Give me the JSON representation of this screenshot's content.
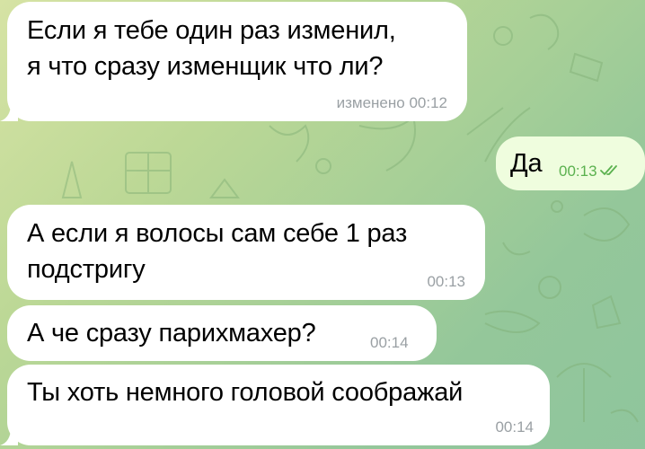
{
  "messages": [
    {
      "text_line1": "Если я тебе один раз изменил,",
      "text_line2": "я что сразу изменщик что ли?",
      "meta": "изменено 00:12",
      "direction": "incoming"
    },
    {
      "text": "Да",
      "meta": "00:13",
      "status": "read",
      "direction": "outgoing"
    },
    {
      "text_line1": "А если я волосы сам себе 1 раз",
      "text_line2": "подстригу",
      "meta": "00:13",
      "direction": "incoming"
    },
    {
      "text": "А че сразу парихмахер?",
      "meta": "00:14",
      "direction": "incoming"
    },
    {
      "text": "Ты хоть немного головой соображай",
      "meta": "00:14",
      "direction": "incoming"
    }
  ],
  "colors": {
    "incoming_bubble": "#ffffff",
    "outgoing_bubble": "#effdde",
    "outgoing_meta": "#5bb14f",
    "incoming_meta": "#9aa0a4"
  },
  "icons": {
    "read_receipt": "double-check-icon",
    "background": "chat-wallpaper-doodles"
  }
}
